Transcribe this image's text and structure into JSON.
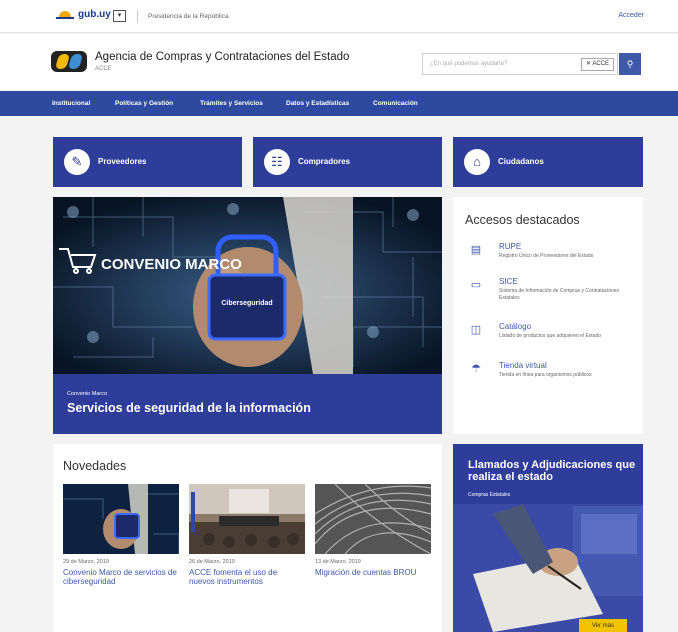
{
  "gub": {
    "brand": "gub.uy",
    "presidency": "Presidencia de la República",
    "login": "Acceder"
  },
  "header": {
    "org_name": "Agencia de Compras y Contrataciones del Estado",
    "org_abbr": "ACCE"
  },
  "search": {
    "placeholder": "¿En qué podemos ayudarte?",
    "scope": "ACCE"
  },
  "nav": [
    "Institucional",
    "Políticas y Gestión",
    "Trámites y Servicios",
    "Datos y Estadísticas",
    "Comunicación"
  ],
  "categories": [
    {
      "label": "Proveedores",
      "icon": "document-pen-icon"
    },
    {
      "label": "Compradores",
      "icon": "shopping-basket-icon"
    },
    {
      "label": "Ciudadanos",
      "icon": "building-icon"
    }
  ],
  "hero": {
    "image_text": "CONVENIO MARCO",
    "badge_text": "Ciberseguridad",
    "kicker": "Convenio Marco",
    "title": "Servicios de seguridad de la información"
  },
  "accesos": {
    "title": "Accesos destacados",
    "items": [
      {
        "name": "RUPE",
        "desc": "Registro Único de Proveedores del Estado",
        "icon": "briefcase-icon"
      },
      {
        "name": "SICE",
        "desc": "Sistema de Información de Compras y Contrataciones Estatales",
        "icon": "monitor-icon"
      },
      {
        "name": "Catálogo",
        "desc": "Listado de productos que adquieren el Estado",
        "icon": "catalog-icon"
      },
      {
        "name": "Tienda virtual",
        "desc": "Tienda en línea para organismos públicos",
        "icon": "shopping-cart-icon"
      }
    ]
  },
  "novedades": {
    "title": "Novedades",
    "items": [
      {
        "date": "29 de Marzo, 2019",
        "title": "Convenio Marco de servicios de ciberseguridad"
      },
      {
        "date": "26 de Marzo, 2019",
        "title": "ACCE fomenta el uso de nuevos instrumentos"
      },
      {
        "date": "13 de Marzo, 2019",
        "title": "Migración de cuentas BROU"
      }
    ]
  },
  "llamados": {
    "title": "Llamados y Adjudicaciones que realiza el estado",
    "subtitle": "Compras Estatales",
    "button": "Ver más"
  },
  "colors": {
    "primary": "#2e3d99",
    "nav": "#2e4aa0",
    "link": "#3d59a8",
    "accent": "#f2c400"
  }
}
